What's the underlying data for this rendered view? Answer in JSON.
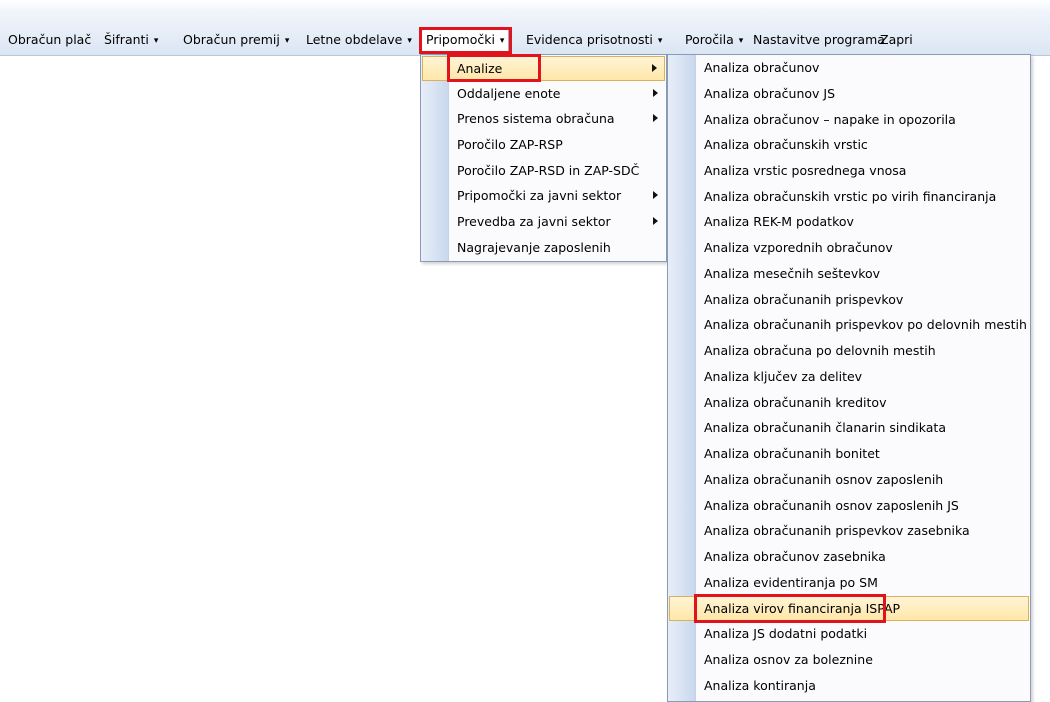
{
  "menubar": {
    "items": [
      {
        "label": "Obračun plač"
      },
      {
        "label": "Šifranti",
        "caret": "▾"
      },
      {
        "label": "Obračun premij",
        "caret": "▾"
      },
      {
        "label": "Letne obdelave",
        "caret": "▾"
      },
      {
        "label": "Pripomočki",
        "caret": "▾"
      },
      {
        "label": "Evidenca prisotnosti",
        "caret": "▾"
      },
      {
        "label": "Poročila",
        "caret": "▾"
      },
      {
        "label": "Nastavitve programa"
      },
      {
        "label": "Zapri"
      }
    ]
  },
  "pripomocki_menu": {
    "items": [
      {
        "label": "Analize",
        "submenu": true
      },
      {
        "label": "Oddaljene enote",
        "submenu": true
      },
      {
        "label": "Prenos sistema obračuna",
        "submenu": true
      },
      {
        "label": "Poročilo ZAP-RSP"
      },
      {
        "label": "Poročilo ZAP-RSD  in ZAP-SDČ"
      },
      {
        "label": "Pripomočki za javni sektor",
        "submenu": true
      },
      {
        "label": "Prevedba za javni sektor",
        "submenu": true
      },
      {
        "label": "Nagrajevanje zaposlenih"
      }
    ]
  },
  "analize_menu": {
    "items": [
      {
        "label": "Analiza obračunov"
      },
      {
        "label": "Analiza obračunov JS"
      },
      {
        "label": "Analiza obračunov – napake in opozorila"
      },
      {
        "label": "Analiza obračunskih vrstic"
      },
      {
        "label": "Analiza vrstic posrednega vnosa"
      },
      {
        "label": "Analiza obračunskih vrstic po virih financiranja"
      },
      {
        "label": "Analiza REK-M podatkov"
      },
      {
        "label": "Analiza vzporednih obračunov"
      },
      {
        "label": "Analiza mesečnih seštevkov"
      },
      {
        "label": "Analiza obračunanih prispevkov"
      },
      {
        "label": "Analiza obračunanih prispevkov po delovnih mestih"
      },
      {
        "label": "Analiza obračuna po delovnih mestih"
      },
      {
        "label": "Analiza ključev za delitev"
      },
      {
        "label": "Analiza obračunanih kreditov"
      },
      {
        "label": "Analiza obračunanih članarin sindikata"
      },
      {
        "label": "Analiza obračunanih bonitet"
      },
      {
        "label": "Analiza obračunanih osnov zaposlenih"
      },
      {
        "label": "Analiza obračunanih osnov zaposlenih JS"
      },
      {
        "label": "Analiza obračunanih prispevkov zasebnika"
      },
      {
        "label": "Analiza obračunov zasebnika"
      },
      {
        "label": "Analiza evidentiranja po SM"
      },
      {
        "label": "Analiza virov financiranja ISPAP"
      },
      {
        "label": "Analiza JS dodatni podatki"
      },
      {
        "label": "Analiza osnov za boleznine"
      },
      {
        "label": "Analiza kontiranja"
      }
    ]
  }
}
